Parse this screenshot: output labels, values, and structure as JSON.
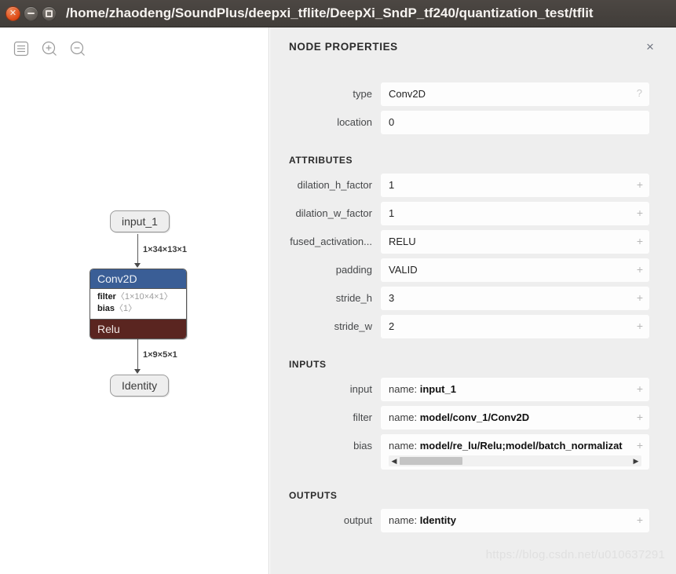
{
  "window": {
    "title": "/home/zhaodeng/SoundPlus/deepxi_tflite/DeepXi_SndP_tf240/quantization_test/tflit",
    "controls": {
      "close": "close-button",
      "minimize": "minimize-button",
      "maximize": "maximize-button"
    }
  },
  "graph_toolbar": {
    "menu_icon": "hamburger-menu-icon",
    "zoom_in_icon": "zoom-in-icon",
    "zoom_out_icon": "zoom-out-icon"
  },
  "graph": {
    "input_node": {
      "label": "input_1"
    },
    "conv_node": {
      "type": "Conv2D",
      "attributes": [
        {
          "name": "filter",
          "dims": "〈1×10×4×1〉"
        },
        {
          "name": "bias",
          "dims": "〈1〉"
        }
      ],
      "activation": "Relu",
      "header_color": "#3a5e96",
      "footer_color": "#5a2520"
    },
    "output_node": {
      "label": "Identity"
    },
    "edges": [
      {
        "label": "1×34×13×1"
      },
      {
        "label": "1×9×5×1"
      }
    ]
  },
  "properties": {
    "title": "NODE PROPERTIES",
    "close_label": "×",
    "top_fields": [
      {
        "label": "type",
        "value": "Conv2D",
        "badge": "?"
      },
      {
        "label": "location",
        "value": "0",
        "badge": ""
      }
    ],
    "sections": [
      {
        "heading": "ATTRIBUTES",
        "rows": [
          {
            "label": "dilation_h_factor",
            "value": "1",
            "badge": "+"
          },
          {
            "label": "dilation_w_factor",
            "value": "1",
            "badge": "+"
          },
          {
            "label": "fused_activation...",
            "value": "RELU",
            "badge": "+"
          },
          {
            "label": "padding",
            "value": "VALID",
            "badge": "+"
          },
          {
            "label": "stride_h",
            "value": "3",
            "badge": "+"
          },
          {
            "label": "stride_w",
            "value": "2",
            "badge": "+"
          }
        ]
      },
      {
        "heading": "INPUTS",
        "rows": [
          {
            "label": "input",
            "prefix": "name: ",
            "value": "input_1",
            "badge": "+"
          },
          {
            "label": "filter",
            "prefix": "name: ",
            "value": "model/conv_1/Conv2D",
            "badge": "+"
          },
          {
            "label": "bias",
            "prefix": "name: ",
            "value": "model/re_lu/Relu;model/batch_normalizat",
            "badge": "+",
            "scrollbar": true
          }
        ]
      },
      {
        "heading": "OUTPUTS",
        "rows": [
          {
            "label": "output",
            "prefix": "name: ",
            "value": "Identity",
            "badge": "+"
          }
        ]
      }
    ]
  },
  "watermark": "https://blog.csdn.net/u010637291"
}
